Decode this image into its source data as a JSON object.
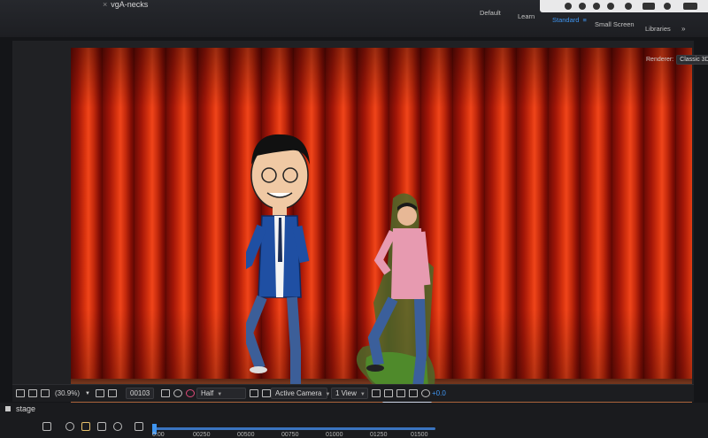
{
  "header": {
    "comp_tab": "vgA-necks",
    "workspaces": [
      "Default",
      "Learn",
      "Standard",
      "Small Screen",
      "Libraries"
    ],
    "active_workspace": "Standard",
    "more_glyph": "»",
    "renderer_label": "Renderer:",
    "renderer_value": "Classic 3D"
  },
  "toolbar": {
    "zoom": "(30.9%)",
    "timecode": "00103",
    "resolution": "Half",
    "camera": "Active Camera",
    "view": "1 View",
    "exposure": "+0.0"
  },
  "timeline": {
    "comp_name": "stage",
    "ticks": [
      "0:00",
      "00250",
      "00500",
      "00750",
      "01000",
      "01250",
      "01500"
    ]
  },
  "colors": {
    "accent": "#3f95f0",
    "curtain": "#d8330f",
    "floor": "#c9804f"
  }
}
